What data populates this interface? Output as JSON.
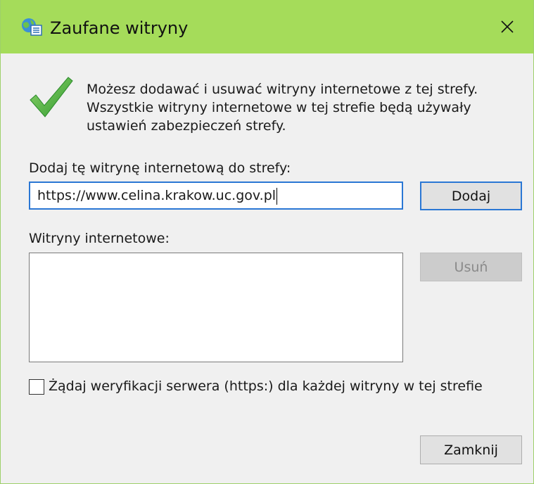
{
  "window": {
    "title": "Zaufane witryny",
    "title_icon": "zone-globe-icon",
    "close_icon": "close-icon",
    "accent_color": "#a5dc5a"
  },
  "info": {
    "icon": "checkmark-icon",
    "lines": [
      "Możesz dodawać i usuwać witryny internetowe z tej strefy.",
      "Wszystkie witryny internetowe w tej strefie będą używały",
      "ustawień zabezpieczeń strefy."
    ]
  },
  "add_section": {
    "label": "Dodaj tę witrynę internetową do strefy:",
    "input_value": "https://www.celina.krakow.uc.gov.pl",
    "add_button": "Dodaj"
  },
  "sites_section": {
    "label": "Witryny internetowe:",
    "items": [],
    "remove_button": "Usuń"
  },
  "verification": {
    "checked": false,
    "label": "Żądaj weryfikacji serwera (https:) dla każdej witryny w tej strefie"
  },
  "footer": {
    "close_button": "Zamknij"
  }
}
